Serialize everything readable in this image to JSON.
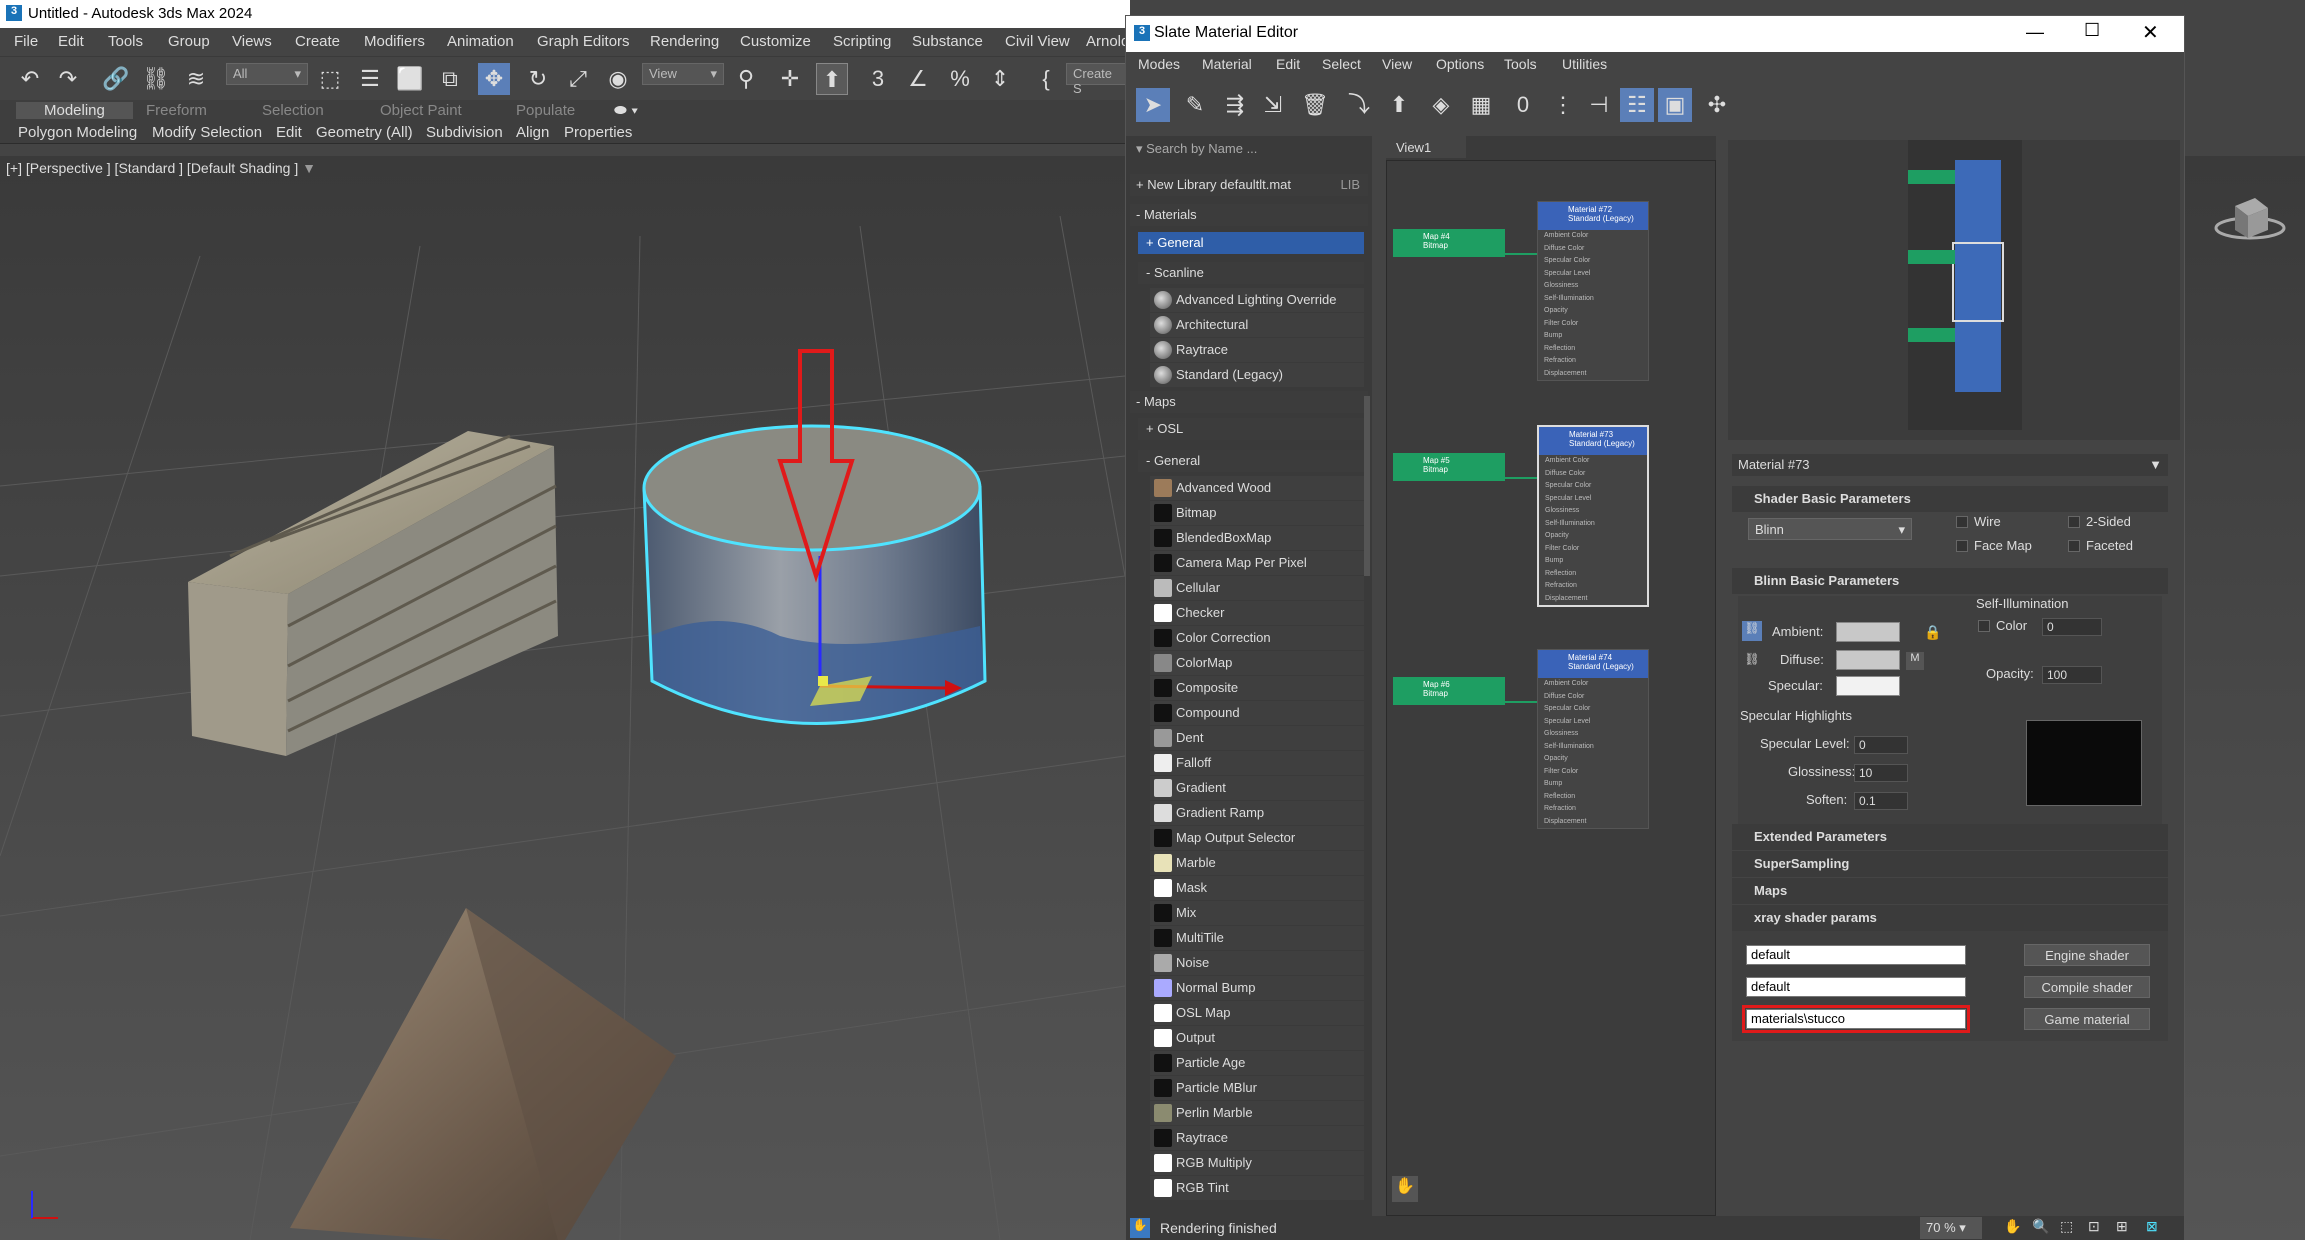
{
  "app": {
    "title": "Untitled - Autodesk 3ds Max 2024",
    "menu": [
      "File",
      "Edit",
      "Tools",
      "Group",
      "Views",
      "Create",
      "Modifiers",
      "Animation",
      "Graph Editors",
      "Rendering",
      "Customize",
      "Scripting",
      "Substance",
      "Civil View",
      "Arnold"
    ],
    "toolbar": {
      "filter_value": "All",
      "coord_value": "View",
      "create_selection": "Create S"
    },
    "ribbon_tabs": [
      "Modeling",
      "Freeform",
      "Selection",
      "Object Paint",
      "Populate"
    ],
    "ribbon_items": [
      "Polygon Modeling",
      "Modify Selection",
      "Edit",
      "Geometry (All)",
      "Subdivision",
      "Align",
      "Properties"
    ],
    "viewport_label": "[+] [Perspective ] [Standard ] [Default Shading ]"
  },
  "slate": {
    "title": "Slate Material Editor",
    "menu": [
      "Modes",
      "Material",
      "Edit",
      "Select",
      "View",
      "Options",
      "Tools",
      "Utilities"
    ],
    "search_placeholder": "Search by Name ...",
    "library": "+ New Library defaultlt.mat",
    "library_tag": "LIB",
    "materials_header": "- Materials",
    "general_header": "+ General",
    "scanline_header": "- Scanline",
    "scanline_items": [
      "Advanced Lighting Override",
      "Architectural",
      "Raytrace",
      "Standard (Legacy)"
    ],
    "maps_header": "- Maps",
    "osl_header": "+ OSL",
    "maps_general_header": "- General",
    "maps_items": [
      {
        "label": "Advanced Wood",
        "color": "#9c7b5a"
      },
      {
        "label": "Bitmap",
        "color": "#111111"
      },
      {
        "label": "BlendedBoxMap",
        "color": "#111111"
      },
      {
        "label": "Camera Map Per Pixel",
        "color": "#111111"
      },
      {
        "label": "Cellular",
        "color": "#bbbbbb"
      },
      {
        "label": "Checker",
        "color": "#ffffff"
      },
      {
        "label": "Color Correction",
        "color": "#111111"
      },
      {
        "label": "ColorMap",
        "color": "#888888"
      },
      {
        "label": "Composite",
        "color": "#111111"
      },
      {
        "label": "Compound",
        "color": "#111111"
      },
      {
        "label": "Dent",
        "color": "#999999"
      },
      {
        "label": "Falloff",
        "color": "#eeeeee"
      },
      {
        "label": "Gradient",
        "color": "#cccccc"
      },
      {
        "label": "Gradient Ramp",
        "color": "#dddddd"
      },
      {
        "label": "Map Output Selector",
        "color": "#111111"
      },
      {
        "label": "Marble",
        "color": "#e8e2b8"
      },
      {
        "label": "Mask",
        "color": "#ffffff"
      },
      {
        "label": "Mix",
        "color": "#111111"
      },
      {
        "label": "MultiTile",
        "color": "#111111"
      },
      {
        "label": "Noise",
        "color": "#aaaaaa"
      },
      {
        "label": "Normal Bump",
        "color": "#aaaaff"
      },
      {
        "label": "OSL Map",
        "color": "#ffffff"
      },
      {
        "label": "Output",
        "color": "#ffffff"
      },
      {
        "label": "Particle Age",
        "color": "#111111"
      },
      {
        "label": "Particle MBlur",
        "color": "#111111"
      },
      {
        "label": "Perlin Marble",
        "color": "#8b8b70"
      },
      {
        "label": "Raytrace",
        "color": "#111111"
      },
      {
        "label": "RGB Multiply",
        "color": "#ffffff"
      },
      {
        "label": "RGB Tint",
        "color": "#ffffff"
      }
    ],
    "view_tab": "View1",
    "nodes": [
      {
        "title": "Material #72",
        "sub": "Standard (Legacy)",
        "map": "Map #4",
        "map_sub": "Bitmap"
      },
      {
        "title": "Material #73",
        "sub": "Standard (Legacy)",
        "map": "Map #5",
        "map_sub": "Bitmap"
      },
      {
        "title": "Material #74",
        "sub": "Standard (Legacy)",
        "map": "Map #6",
        "map_sub": "Bitmap"
      }
    ],
    "slots": [
      "Ambient Color",
      "Diffuse Color",
      "Specular Color",
      "Specular Level",
      "Glossiness",
      "Self-Illumination",
      "Opacity",
      "Filter Color",
      "Bump",
      "Reflection",
      "Refraction",
      "Displacement"
    ],
    "material_name": "Material #73",
    "shader_section": "Shader Basic Parameters",
    "shader_value": "Blinn",
    "shader_opts": [
      "Wire",
      "2-Sided",
      "Face Map",
      "Faceted"
    ],
    "blinn_section": "Blinn Basic Parameters",
    "self_illum": "Self-Illumination",
    "color_label": "Color",
    "color_value": "0",
    "ambient": "Ambient:",
    "diffuse": "Diffuse:",
    "specular": "Specular:",
    "m_label": "M",
    "opacity_label": "Opacity:",
    "opacity_value": "100",
    "spec_highlights": "Specular Highlights",
    "spec_level_label": "Specular Level:",
    "spec_level_value": "0",
    "glossiness_label": "Glossiness:",
    "glossiness_value": "10",
    "soften_label": "Soften:",
    "soften_value": "0.1",
    "collapsed_sections": [
      "Extended Parameters",
      "SuperSampling",
      "Maps"
    ],
    "xray_section": "xray shader params",
    "xray_fields": [
      "default",
      "default",
      "materials\\stucco"
    ],
    "xray_buttons": [
      "Engine shader",
      "Compile shader",
      "Game material"
    ],
    "status": "Rendering finished",
    "zoom": "70 %"
  }
}
